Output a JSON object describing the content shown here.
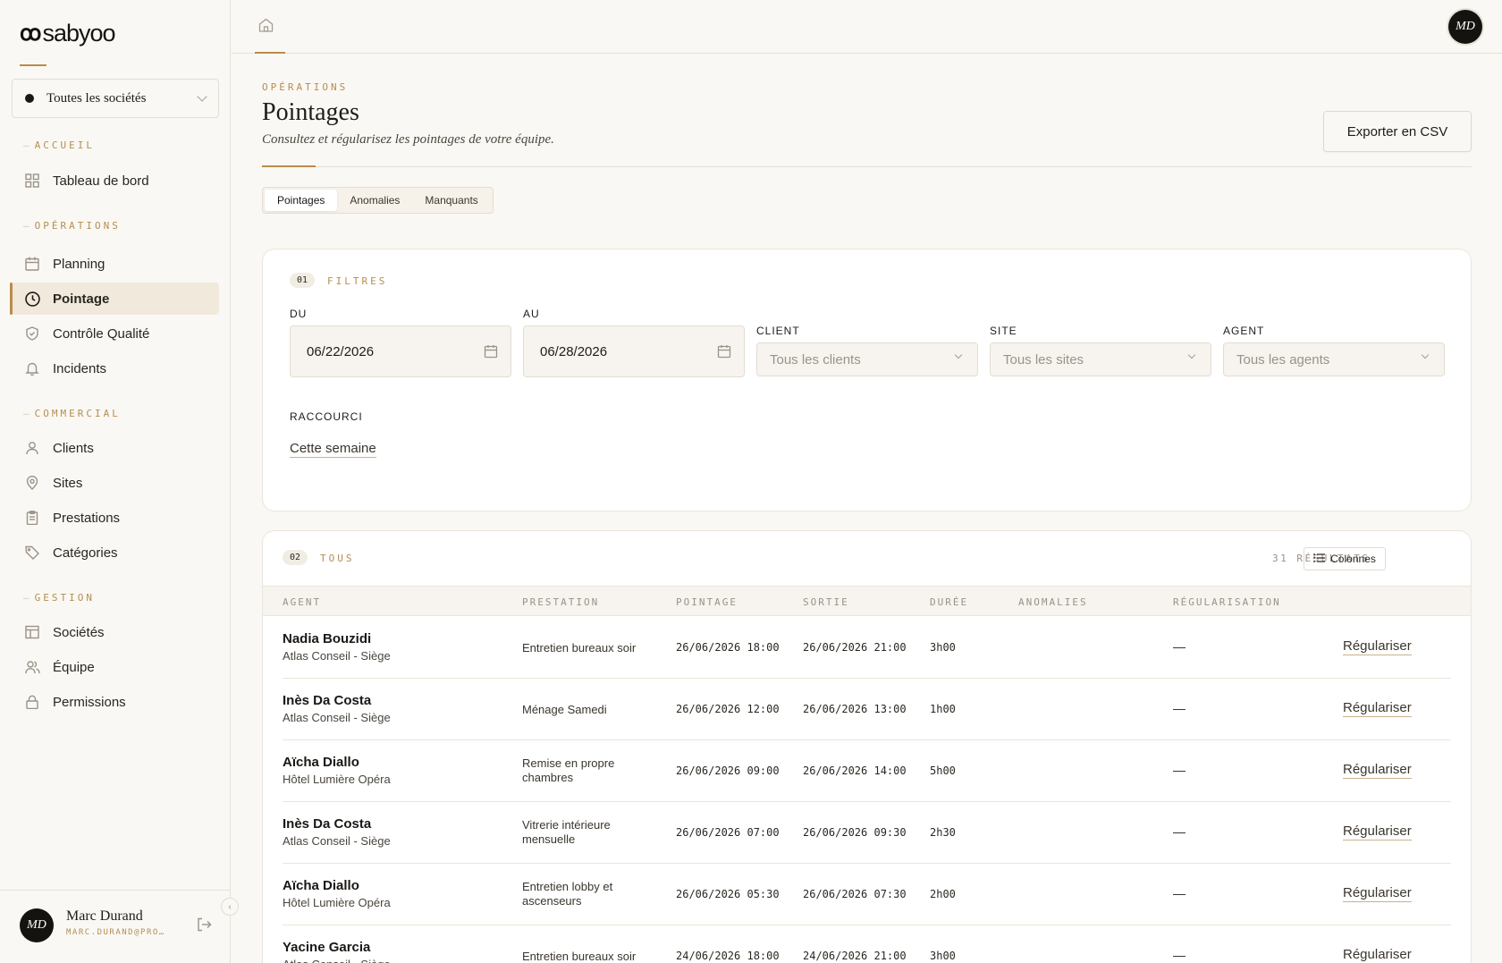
{
  "brand": {
    "name": "sabyoo",
    "mark": "ꝏ"
  },
  "company_select": {
    "value": "Toutes les sociétés"
  },
  "sidebar": {
    "sections": [
      {
        "label": "ACCUEIL",
        "items": [
          {
            "label": "Tableau de bord",
            "icon": "grid-icon"
          }
        ]
      },
      {
        "label": "OPÉRATIONS",
        "items": [
          {
            "label": "Planning",
            "icon": "calendar-icon"
          },
          {
            "label": "Pointage",
            "icon": "clock-icon",
            "active": true
          },
          {
            "label": "Contrôle Qualité",
            "icon": "shield-icon"
          },
          {
            "label": "Incidents",
            "icon": "bell-icon"
          }
        ]
      },
      {
        "label": "COMMERCIAL",
        "items": [
          {
            "label": "Clients",
            "icon": "user-icon"
          },
          {
            "label": "Sites",
            "icon": "map-pin-icon"
          },
          {
            "label": "Prestations",
            "icon": "clipboard-icon"
          },
          {
            "label": "Catégories",
            "icon": "tag-icon"
          }
        ]
      },
      {
        "label": "GESTION",
        "items": [
          {
            "label": "Sociétés",
            "icon": "building-icon"
          },
          {
            "label": "Équipe",
            "icon": "users-icon"
          },
          {
            "label": "Permissions",
            "icon": "lock-icon"
          }
        ]
      }
    ]
  },
  "user": {
    "initials": "MD",
    "name": "Marc Durand",
    "email": "MARC.DURAND@PRO…"
  },
  "header": {
    "eyebrow": "OPÉRATIONS",
    "title": "Pointages",
    "subtitle": "Consultez et régularisez les pointages de votre équipe.",
    "export_label": "Exporter en CSV"
  },
  "tabs": [
    {
      "label": "Pointages",
      "active": true
    },
    {
      "label": "Anomalies"
    },
    {
      "label": "Manquants"
    }
  ],
  "filters": {
    "num": "01",
    "title": "FILTRES",
    "du_label": "DU",
    "du_value": "06/22/2026",
    "au_label": "AU",
    "au_value": "06/28/2026",
    "client_label": "CLIENT",
    "client_placeholder": "Tous les clients",
    "site_label": "SITE",
    "site_placeholder": "Tous les sites",
    "agent_label": "AGENT",
    "agent_placeholder": "Tous les agents",
    "shortcut_label": "RACCOURCI",
    "shortcut_value": "Cette semaine"
  },
  "table": {
    "num": "02",
    "title": "TOUS",
    "results": "31 RÉSULTATS",
    "columns_label": "Colonnes",
    "headers": [
      "AGENT",
      "PRESTATION",
      "POINTAGE",
      "SORTIE",
      "DURÉE",
      "ANOMALIES",
      "RÉGULARISATION"
    ],
    "action_label": "Régulariser",
    "rows": [
      {
        "agent": "Nadia Bouzidi",
        "site": "Atlas Conseil - Siège",
        "prestation": "Entretien bureaux soir",
        "pointage": "26/06/2026 18:00",
        "sortie": "26/06/2026 21:00",
        "duree": "3h00",
        "regularisation": "—"
      },
      {
        "agent": "Inès Da Costa",
        "site": "Atlas Conseil - Siège",
        "prestation": "Ménage Samedi",
        "pointage": "26/06/2026 12:00",
        "sortie": "26/06/2026 13:00",
        "duree": "1h00",
        "regularisation": "—"
      },
      {
        "agent": "Aïcha Diallo",
        "site": "Hôtel Lumière Opéra",
        "prestation": "Remise en propre chambres",
        "pointage": "26/06/2026 09:00",
        "sortie": "26/06/2026 14:00",
        "duree": "5h00",
        "regularisation": "—"
      },
      {
        "agent": "Inès Da Costa",
        "site": "Atlas Conseil - Siège",
        "prestation": "Vitrerie intérieure mensuelle",
        "pointage": "26/06/2026 07:00",
        "sortie": "26/06/2026 09:30",
        "duree": "2h30",
        "regularisation": "—"
      },
      {
        "agent": "Aïcha Diallo",
        "site": "Hôtel Lumière Opéra",
        "prestation": "Entretien lobby et ascenseurs",
        "pointage": "26/06/2026 05:30",
        "sortie": "26/06/2026 07:30",
        "duree": "2h00",
        "regularisation": "—"
      },
      {
        "agent": "Yacine Garcia",
        "site": "Atlas Conseil - Siège",
        "prestation": "Entretien bureaux soir",
        "pointage": "24/06/2026 18:00",
        "sortie": "24/06/2026 21:00",
        "duree": "3h00",
        "regularisation": "—"
      }
    ]
  }
}
